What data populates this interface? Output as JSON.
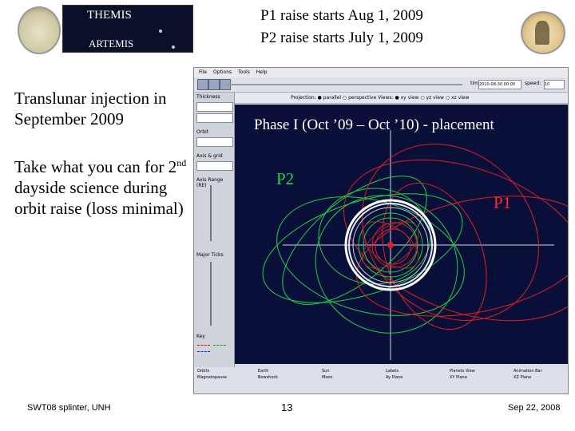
{
  "header": {
    "banner_line1": "THEMIS",
    "banner_line2": "ARTEMIS",
    "line1": "P1 raise starts Aug 1, 2009",
    "line2": "P2 raise starts July 1, 2009"
  },
  "left": {
    "p1": "Translunar injection in September 2009",
    "p2_prefix": "Take what you can for 2",
    "p2_sup": "nd",
    "p2_suffix": " dayside science during orbit raise (loss minimal)"
  },
  "app": {
    "menu": [
      "File",
      "Options",
      "Tools",
      "Help"
    ],
    "time_label": "time:",
    "time_value": "2010-08-30 00:00",
    "speed_label": "speed:",
    "speed_value": "10",
    "side_labels": [
      "Thickness",
      "Orbit",
      "Axis & grid",
      "Axis Range (RE)",
      "Major Ticks",
      "Key"
    ],
    "options_bar": "Projection:  ● parallel  ○ perspective        Views:  ● xy view  ○ yz view  ○ xz view",
    "legend_items": [
      "Orbits",
      "Magnetopause",
      "Earth",
      "Bowshock",
      "Sun",
      "Moon",
      "Labels",
      "Ay Plane",
      "Planets View",
      "XY Plane",
      "Animation Bar",
      "XZ Plane"
    ]
  },
  "plot": {
    "phase_label": "Phase I (Oct ’09 – Oct ’10) - placement",
    "p2_label": "P2",
    "p1_label": "P1",
    "p2_color": "#26d04a",
    "p1_color": "#ff2a2a"
  },
  "footer": {
    "left": "SWT08 splinter, UNH",
    "center": "13",
    "right": "Sep 22, 2008"
  }
}
